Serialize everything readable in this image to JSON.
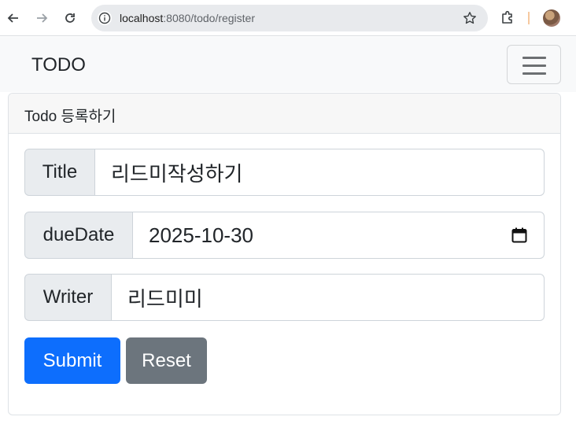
{
  "browser": {
    "url_host": "localhost",
    "url_path": ":8080/todo/register",
    "icons": {
      "back": "arrow-left-icon",
      "forward": "arrow-right-icon",
      "reload": "reload-icon",
      "site_info": "info-icon",
      "bookmark": "star-icon",
      "extensions": "puzzle-icon",
      "profile": "avatar"
    }
  },
  "navbar": {
    "brand": "TODO",
    "toggler_icon": "hamburger-icon"
  },
  "card": {
    "header": "Todo 등록하기",
    "fields": {
      "title": {
        "label": "Title",
        "value": "리드미작성하기"
      },
      "due_date": {
        "label": "dueDate",
        "value": "2025-10-30",
        "icon": "calendar-icon"
      },
      "writer": {
        "label": "Writer",
        "value": "리드미미"
      }
    },
    "buttons": {
      "submit": "Submit",
      "reset": "Reset"
    }
  },
  "colors": {
    "primary": "#0d6efd",
    "secondary": "#6c757d",
    "navbar_bg": "#f8f9fa",
    "addon_bg": "#e9ecef"
  }
}
